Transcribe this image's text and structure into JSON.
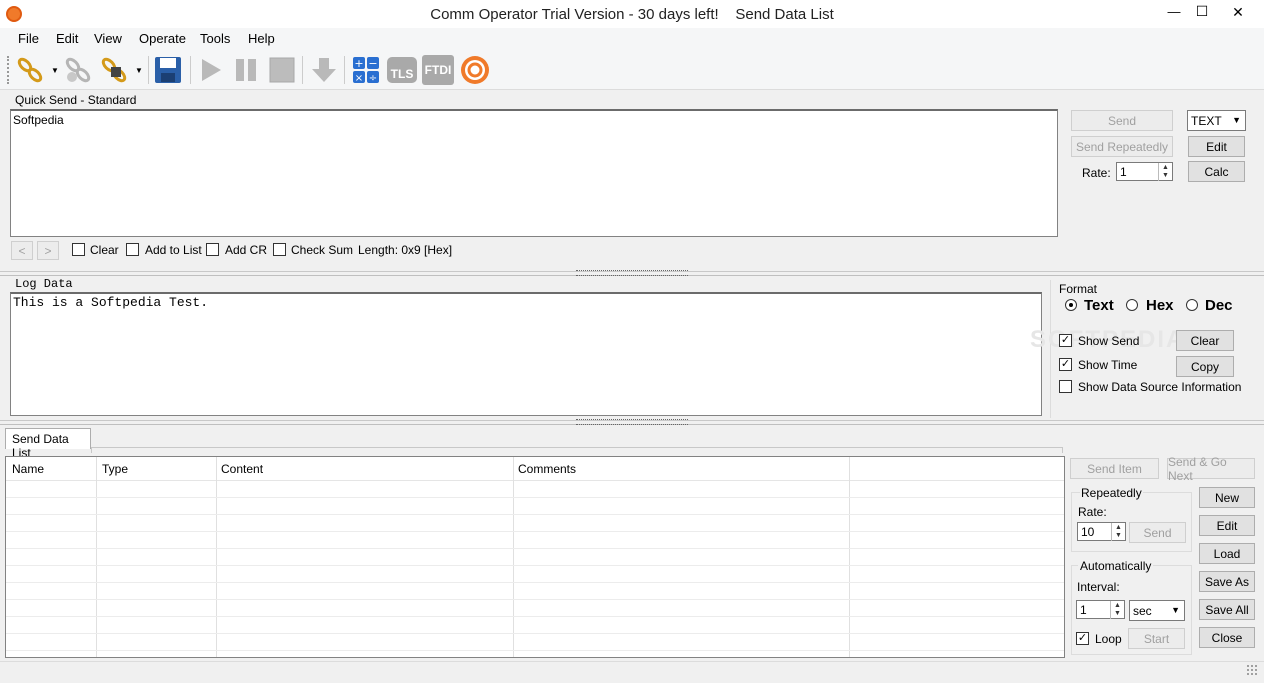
{
  "window": {
    "title": "Comm Operator Trial Version - 30 days left!    Send Data List",
    "min_glyph": "—",
    "max_glyph": "☐",
    "close_glyph": "✕"
  },
  "menu": [
    "File",
    "Edit",
    "View",
    "Operate",
    "Tools",
    "Help"
  ],
  "toolbar": {
    "tls": "TLS",
    "ftdi": "FTDI"
  },
  "quick_send": {
    "group_label": "Quick Send - Standard",
    "text": "Softpedia",
    "nav_prev": "<",
    "nav_next": ">",
    "clear": "Clear",
    "add_to_list": "Add to List",
    "add_cr": "Add CR",
    "check_sum": "Check Sum",
    "length": "Length: 0x9 [Hex]",
    "send": "Send",
    "send_repeatedly": "Send Repeatedly",
    "rate_label": "Rate:",
    "rate_value": "1",
    "mode": "TEXT",
    "edit": "Edit",
    "calc": "Calc"
  },
  "log": {
    "group_label": "Log Data",
    "text": "This is a Softpedia Test.",
    "format_label": "Format",
    "format_text": "Text",
    "format_hex": "Hex",
    "format_dec": "Dec",
    "show_send": "Show Send",
    "show_time": "Show Time",
    "show_source": "Show Data Source Information",
    "clear": "Clear",
    "copy": "Copy",
    "watermark": "SOFTPEDIA"
  },
  "send_list": {
    "tab": "Send Data List",
    "columns": [
      "Name",
      "Type",
      "Content",
      "Comments"
    ],
    "send_item": "Send Item",
    "send_go_next": "Send & Go Next",
    "repeatedly_label": "Repeatedly",
    "rate_label": "Rate:",
    "rate_value": "10",
    "send": "Send",
    "automatically_label": "Automatically",
    "interval_label": "Interval:",
    "interval_value": "1",
    "interval_unit": "sec",
    "loop": "Loop",
    "start": "Start",
    "new": "New",
    "edit": "Edit",
    "load": "Load",
    "save_as": "Save As",
    "save_all": "Save All",
    "close": "Close"
  }
}
